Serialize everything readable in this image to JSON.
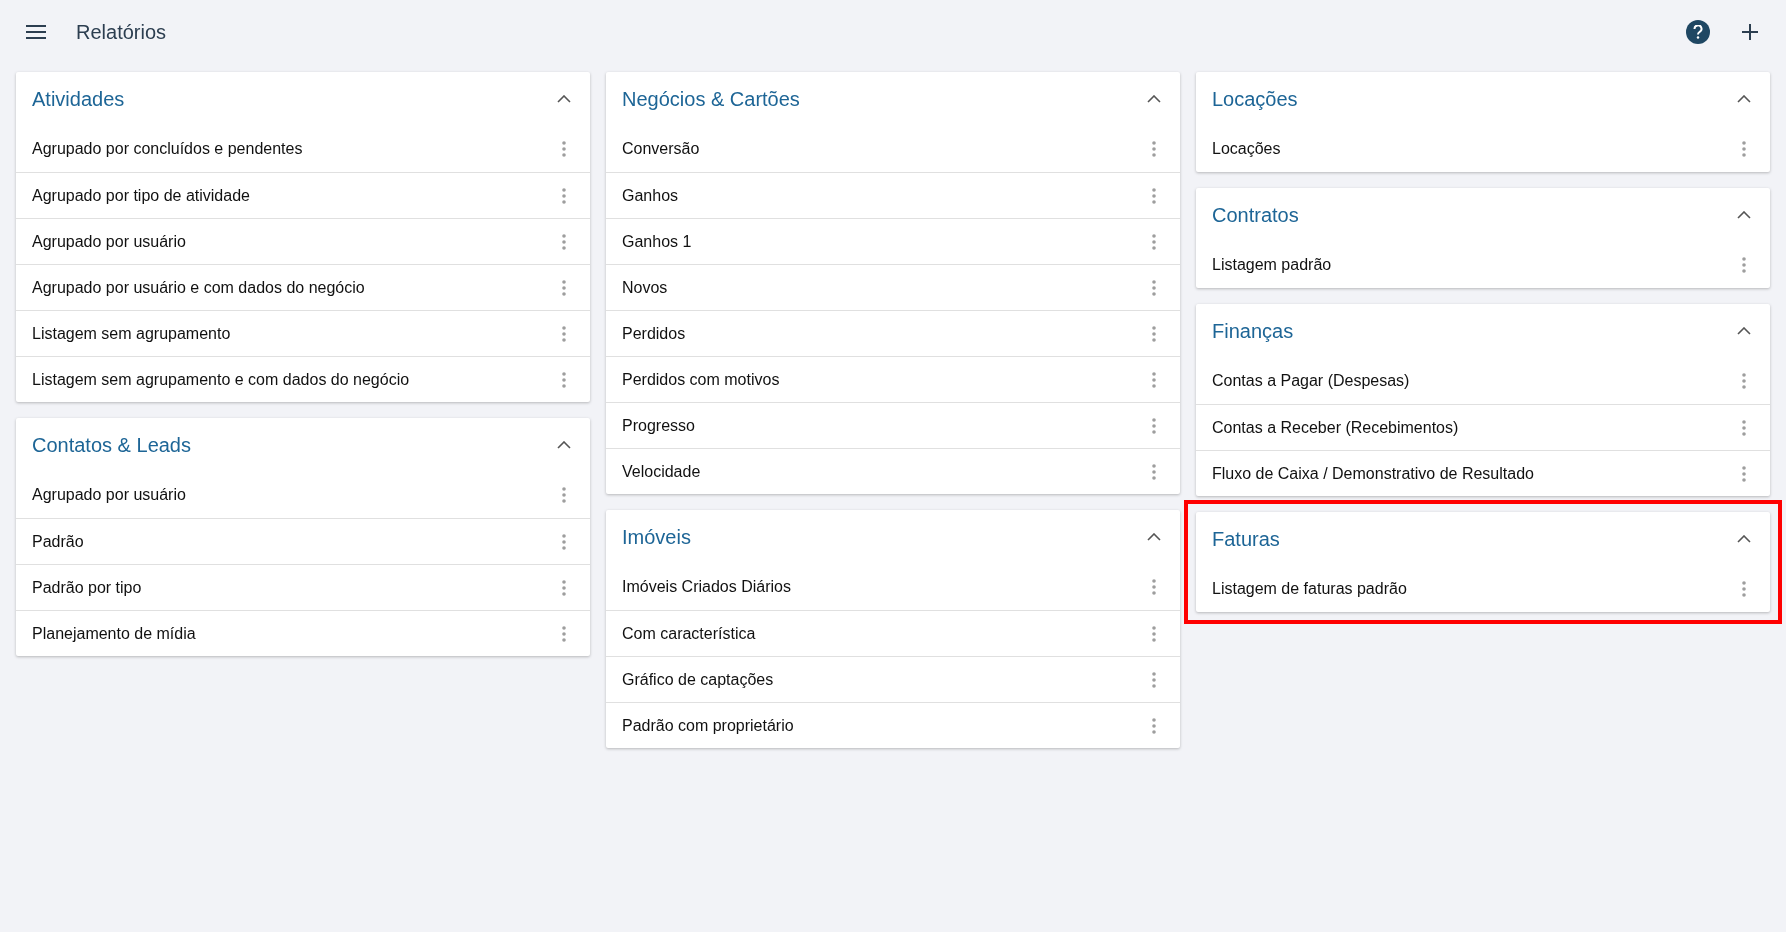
{
  "header": {
    "title": "Relatórios"
  },
  "columns": [
    [
      {
        "title": "Atividades",
        "expanded": true,
        "highlighted": false,
        "items": [
          "Agrupado por concluídos e pendentes",
          "Agrupado por tipo de atividade",
          "Agrupado por usuário",
          "Agrupado por usuário e com dados do negócio",
          "Listagem sem agrupamento",
          "Listagem sem agrupamento e com dados do negócio"
        ]
      },
      {
        "title": "Contatos & Leads",
        "expanded": true,
        "highlighted": false,
        "items": [
          "Agrupado por usuário",
          "Padrão",
          "Padrão por tipo",
          "Planejamento de mídia"
        ]
      }
    ],
    [
      {
        "title": "Negócios & Cartões",
        "expanded": true,
        "highlighted": false,
        "items": [
          "Conversão",
          "Ganhos",
          "Ganhos 1",
          "Novos",
          "Perdidos",
          "Perdidos com motivos",
          "Progresso",
          "Velocidade"
        ]
      },
      {
        "title": "Imóveis",
        "expanded": true,
        "highlighted": false,
        "items": [
          "Imóveis Criados Diários",
          "Com característica",
          "Gráfico de captações",
          "Padrão com proprietário"
        ]
      }
    ],
    [
      {
        "title": "Locações",
        "expanded": true,
        "highlighted": false,
        "items": [
          "Locações"
        ]
      },
      {
        "title": "Contratos",
        "expanded": true,
        "highlighted": false,
        "items": [
          "Listagem padrão"
        ]
      },
      {
        "title": "Finanças",
        "expanded": true,
        "highlighted": false,
        "items": [
          "Contas a Pagar (Despesas)",
          "Contas a Receber (Recebimentos)",
          "Fluxo de Caixa / Demonstrativo de Resultado"
        ]
      },
      {
        "title": "Faturas",
        "expanded": true,
        "highlighted": true,
        "items": [
          "Listagem de faturas padrão"
        ]
      }
    ]
  ]
}
